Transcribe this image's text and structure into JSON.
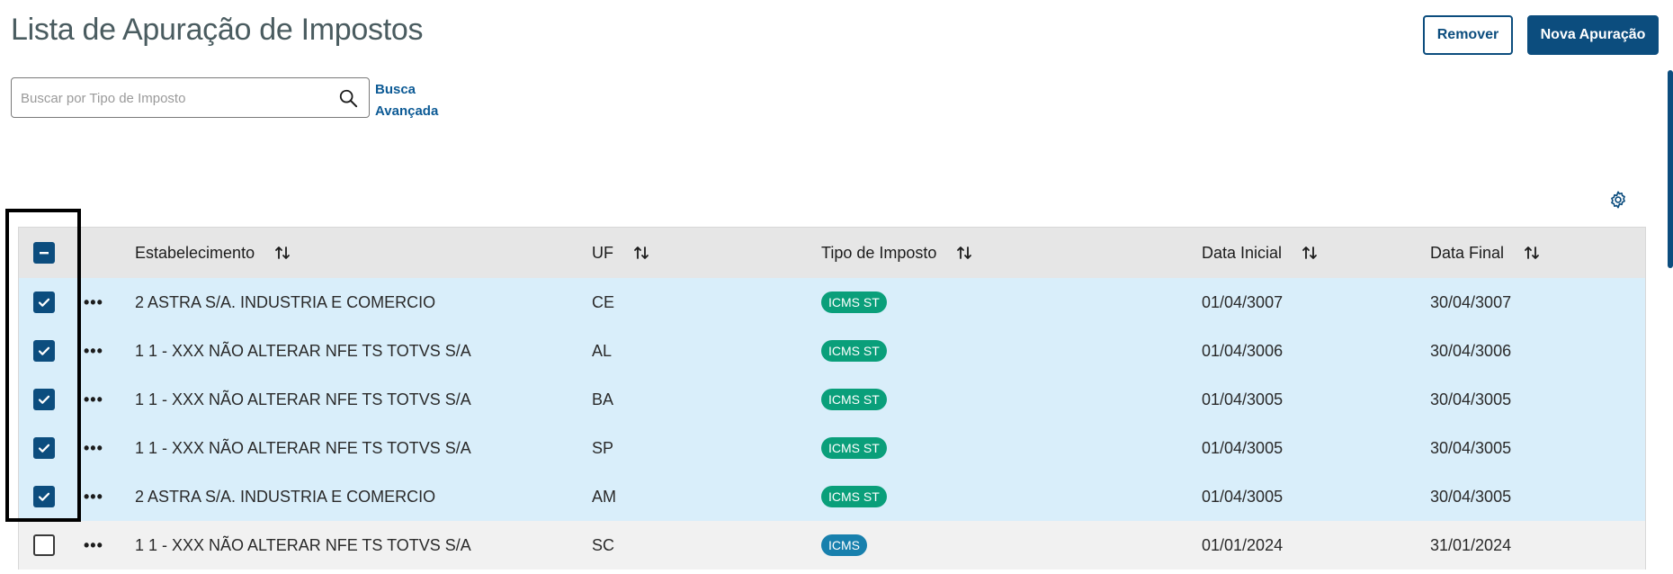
{
  "page": {
    "title": "Lista de Apuração de Impostos"
  },
  "actions": {
    "remove_label": "Remover",
    "new_label": "Nova Apuração"
  },
  "search": {
    "placeholder": "Buscar por Tipo de Imposto",
    "advanced_line1": "Busca",
    "advanced_line2": "Avançada"
  },
  "table": {
    "columns": {
      "estabelecimento": "Estabelecimento",
      "uf": "UF",
      "tipo": "Tipo de Imposto",
      "data_inicial": "Data Inicial",
      "data_final": "Data Final"
    },
    "rows": [
      {
        "estabelecimento": "2 ASTRA S/A. INDUSTRIA E COMERCIO",
        "uf": "CE",
        "tipo": "ICMS ST",
        "data_inicial": "01/04/3007",
        "data_final": "30/04/3007",
        "selected": true
      },
      {
        "estabelecimento": "1 1 - XXX NÃO ALTERAR NFE TS TOTVS S/A",
        "uf": "AL",
        "tipo": "ICMS ST",
        "data_inicial": "01/04/3006",
        "data_final": "30/04/3006",
        "selected": true
      },
      {
        "estabelecimento": "1 1 - XXX NÃO ALTERAR NFE TS TOTVS S/A",
        "uf": "BA",
        "tipo": "ICMS ST",
        "data_inicial": "01/04/3005",
        "data_final": "30/04/3005",
        "selected": true
      },
      {
        "estabelecimento": "1 1 - XXX NÃO ALTERAR NFE TS TOTVS S/A",
        "uf": "SP",
        "tipo": "ICMS ST",
        "data_inicial": "01/04/3005",
        "data_final": "30/04/3005",
        "selected": true
      },
      {
        "estabelecimento": "2 ASTRA S/A. INDUSTRIA E COMERCIO",
        "uf": "AM",
        "tipo": "ICMS ST",
        "data_inicial": "01/04/3005",
        "data_final": "30/04/3005",
        "selected": true
      },
      {
        "estabelecimento": "1 1 - XXX NÃO ALTERAR NFE TS TOTVS S/A",
        "uf": "SC",
        "tipo": "ICMS",
        "data_inicial": "01/01/2024",
        "data_final": "31/01/2024",
        "selected": false
      }
    ]
  },
  "colors": {
    "primary": "#0c4d7e",
    "selected_row": "#d9eefa",
    "badge_icms_st": "#0a9f7a",
    "badge_icms": "#1880ad"
  },
  "icons": {
    "search": "search-icon",
    "settings": "gear-icon",
    "sort": "sort-icon",
    "more": "more-actions-icon"
  }
}
